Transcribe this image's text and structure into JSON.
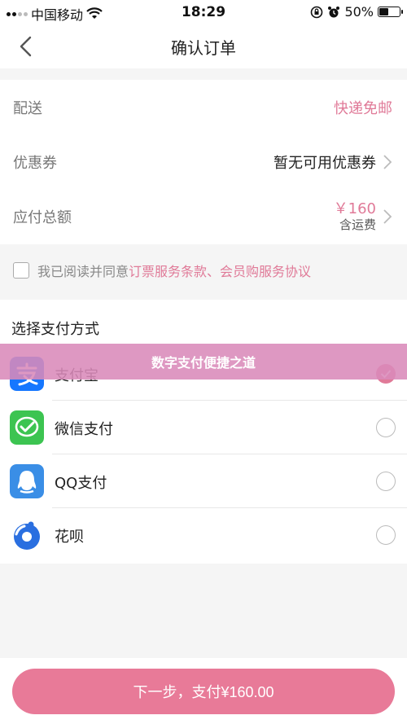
{
  "status_bar": {
    "carrier": "中国移动",
    "time": "18:29",
    "battery": "50%",
    "battery_level": 0.5
  },
  "nav": {
    "title": "确认订单"
  },
  "order_info": {
    "delivery": {
      "label": "配送",
      "value": "快递免邮"
    },
    "coupon": {
      "label": "优惠券",
      "value": "暂无可用优惠券"
    },
    "total": {
      "label": "应付总额",
      "price": "￥160",
      "note": "含运费"
    }
  },
  "agreement": {
    "prefix": "我已阅读并同意",
    "links": "订票服务条款、会员购服务协议"
  },
  "payment": {
    "title": "选择支付方式",
    "methods": [
      {
        "label": "支付宝",
        "selected": true
      },
      {
        "label": "微信支付",
        "selected": false
      },
      {
        "label": "QQ支付",
        "selected": false
      },
      {
        "label": "花呗",
        "selected": false
      }
    ]
  },
  "overlay": {
    "text": "数字支付便捷之道"
  },
  "footer": {
    "button_label": "下一步，支付¥160.00"
  },
  "colors": {
    "accent": "#e07a98",
    "button": "#e87a98",
    "overlay": "#d98ab9",
    "alipay": "#1677ff",
    "wechat": "#3cc451",
    "qq": "#3a8ee6",
    "huabei": "#2a6fe0"
  },
  "icons": [
    "back-arrow-icon",
    "wifi-icon",
    "signal-icon",
    "alarm-icon",
    "lock-rotation-icon",
    "battery-icon",
    "chevron-right-icon",
    "alipay-icon",
    "wechat-pay-icon",
    "qq-pay-icon",
    "huabei-icon",
    "checkmark-icon"
  ]
}
